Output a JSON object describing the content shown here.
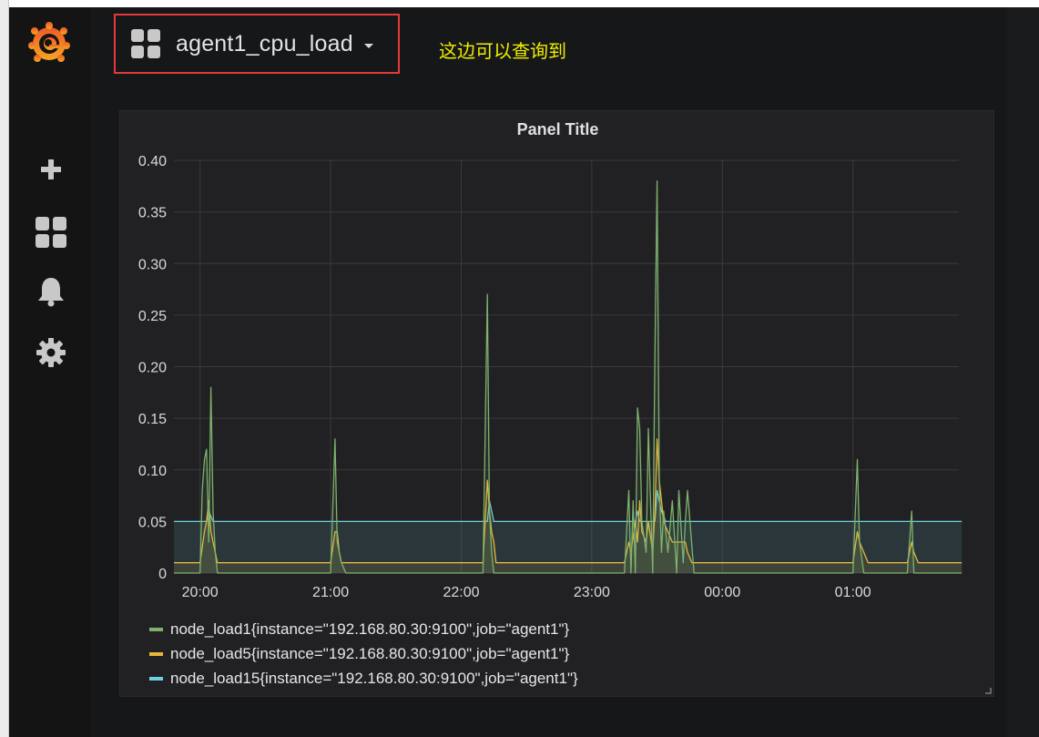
{
  "app": {
    "dashboard_title": "agent1_cpu_load",
    "annotation_text": "这边可以查询到"
  },
  "sidebar": {
    "items": [
      {
        "name": "grafana-logo",
        "icon": "grafana-logo"
      },
      {
        "name": "create",
        "icon": "plus-icon"
      },
      {
        "name": "dashboards",
        "icon": "dashboard-grid-icon"
      },
      {
        "name": "alerting",
        "icon": "bell-icon"
      },
      {
        "name": "configuration",
        "icon": "gear-icon"
      }
    ]
  },
  "colors": {
    "highlight_border": "#e5393a",
    "annotation": "#f0f000",
    "series1": "#7eb26d",
    "series5": "#eab839",
    "series15": "#6ed0e0"
  },
  "panel": {
    "title": "Panel Title"
  },
  "chart_data": {
    "type": "line",
    "title": "Panel Title",
    "xlabel": "",
    "ylabel": "",
    "ylim": [
      0,
      0.4
    ],
    "y_ticks": [
      "0.40",
      "0.35",
      "0.30",
      "0.25",
      "0.20",
      "0.15",
      "0.10",
      "0.05",
      "0"
    ],
    "x_ticks": [
      "20:00",
      "21:00",
      "22:00",
      "23:00",
      "00:00",
      "01:00"
    ],
    "grid": true,
    "legend_position": "bottom",
    "series": [
      {
        "name": "node_load1{instance=\"192.168.80.30:9100\",job=\"agent1\"}",
        "color": "#7eb26d",
        "x": [
          "19:48",
          "20:00",
          "20:01",
          "20:02",
          "20:03",
          "20:04",
          "20:05",
          "20:06",
          "20:07",
          "20:08",
          "20:10",
          "20:15",
          "21:00",
          "21:02",
          "21:03",
          "21:05",
          "21:07",
          "21:10",
          "22:10",
          "22:12",
          "22:13",
          "22:14",
          "22:15",
          "22:17",
          "22:20",
          "23:15",
          "23:17",
          "23:18",
          "23:19",
          "23:20",
          "23:21",
          "23:22",
          "23:23",
          "23:25",
          "23:26",
          "23:28",
          "23:29",
          "23:30",
          "23:31",
          "23:32",
          "23:33",
          "23:35",
          "23:37",
          "23:39",
          "23:40",
          "23:42",
          "23:43",
          "23:44",
          "23:47",
          "23:50",
          "23:52",
          "23:54",
          "00:00",
          "01:00",
          "01:02",
          "01:03",
          "01:05",
          "01:25",
          "01:27",
          "01:28",
          "01:35",
          "01:50"
        ],
        "y": [
          0,
          0,
          0.08,
          0.11,
          0.12,
          0.03,
          0.18,
          0.06,
          0.02,
          0,
          0,
          0,
          0,
          0.13,
          0.03,
          0.01,
          0,
          0,
          0,
          0.27,
          0.06,
          0.02,
          0,
          0,
          0,
          0,
          0.08,
          0,
          0.07,
          0,
          0.16,
          0.14,
          0.05,
          0.02,
          0.14,
          0,
          0.21,
          0.38,
          0.09,
          0.02,
          0.06,
          0.02,
          0.07,
          0,
          0.08,
          0.01,
          0.05,
          0.08,
          0,
          0,
          0,
          0,
          0,
          0,
          0.11,
          0.03,
          0,
          0,
          0.06,
          0,
          0,
          0
        ]
      },
      {
        "name": "node_load5{instance=\"192.168.80.30:9100\",job=\"agent1\"}",
        "color": "#eab839",
        "x": [
          "19:48",
          "20:00",
          "20:02",
          "20:03",
          "20:04",
          "20:05",
          "20:06",
          "20:07",
          "20:08",
          "20:12",
          "21:00",
          "21:02",
          "21:03",
          "21:04",
          "21:05",
          "21:07",
          "21:10",
          "22:10",
          "22:12",
          "22:13",
          "22:14",
          "22:15",
          "22:16",
          "22:20",
          "23:15",
          "23:17",
          "23:18",
          "23:20",
          "23:21",
          "23:22",
          "23:23",
          "23:25",
          "23:26",
          "23:28",
          "23:29",
          "23:30",
          "23:31",
          "23:32",
          "23:33",
          "23:35",
          "23:37",
          "23:40",
          "23:43",
          "23:44",
          "23:46",
          "23:50",
          "23:52",
          "00:00",
          "01:00",
          "01:02",
          "01:03",
          "01:05",
          "01:07",
          "01:25",
          "01:27",
          "01:28",
          "01:30",
          "01:50"
        ],
        "y": [
          0.01,
          0.01,
          0.04,
          0.05,
          0.07,
          0.04,
          0.03,
          0.02,
          0.01,
          0.01,
          0.01,
          0.04,
          0.04,
          0.02,
          0.01,
          0.01,
          0.01,
          0.01,
          0.09,
          0.06,
          0.04,
          0.03,
          0.01,
          0.01,
          0.01,
          0.03,
          0.02,
          0.05,
          0.03,
          0.07,
          0.04,
          0.03,
          0.05,
          0.02,
          0.06,
          0.13,
          0.09,
          0.07,
          0.05,
          0.04,
          0.03,
          0.03,
          0.03,
          0.02,
          0.01,
          0.01,
          0.01,
          0.01,
          0.01,
          0.04,
          0.03,
          0.02,
          0.01,
          0.01,
          0.03,
          0.02,
          0.01,
          0.01
        ]
      },
      {
        "name": "node_load15{instance=\"192.168.80.30:9100\",job=\"agent1\"}",
        "color": "#6ed0e0",
        "x": [
          "19:48",
          "20:03",
          "20:04",
          "20:06",
          "22:12",
          "22:13",
          "22:15",
          "23:20",
          "23:21",
          "23:22",
          "23:29",
          "23:30",
          "23:32",
          "23:34",
          "01:50"
        ],
        "y": [
          0.05,
          0.05,
          0.06,
          0.05,
          0.05,
          0.07,
          0.05,
          0.05,
          0.06,
          0.05,
          0.05,
          0.08,
          0.06,
          0.05,
          0.05
        ]
      }
    ]
  }
}
